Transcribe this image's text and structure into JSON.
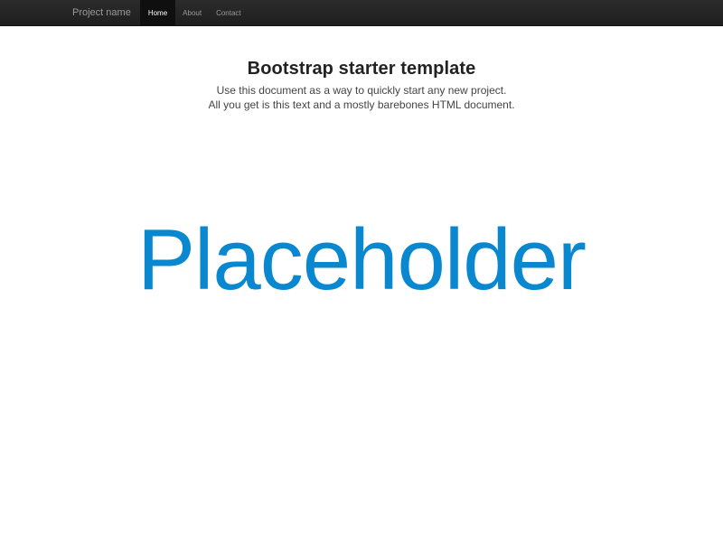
{
  "navbar": {
    "brand": "Project name",
    "items": [
      {
        "label": "Home",
        "active": true
      },
      {
        "label": "About",
        "active": false
      },
      {
        "label": "Contact",
        "active": false
      }
    ]
  },
  "hero": {
    "title": "Bootstrap starter template",
    "lead_line1": "Use this document as a way to quickly start any new project.",
    "lead_line2": "All you get is this text and a mostly barebones HTML document."
  },
  "placeholder": {
    "text": "Placeholder",
    "color": "#0a88cf"
  },
  "colors": {
    "navbar_bg": "#1f1f1f",
    "active_tab_bg": "#0f0f0f",
    "nav_text": "#9a9a9a"
  }
}
